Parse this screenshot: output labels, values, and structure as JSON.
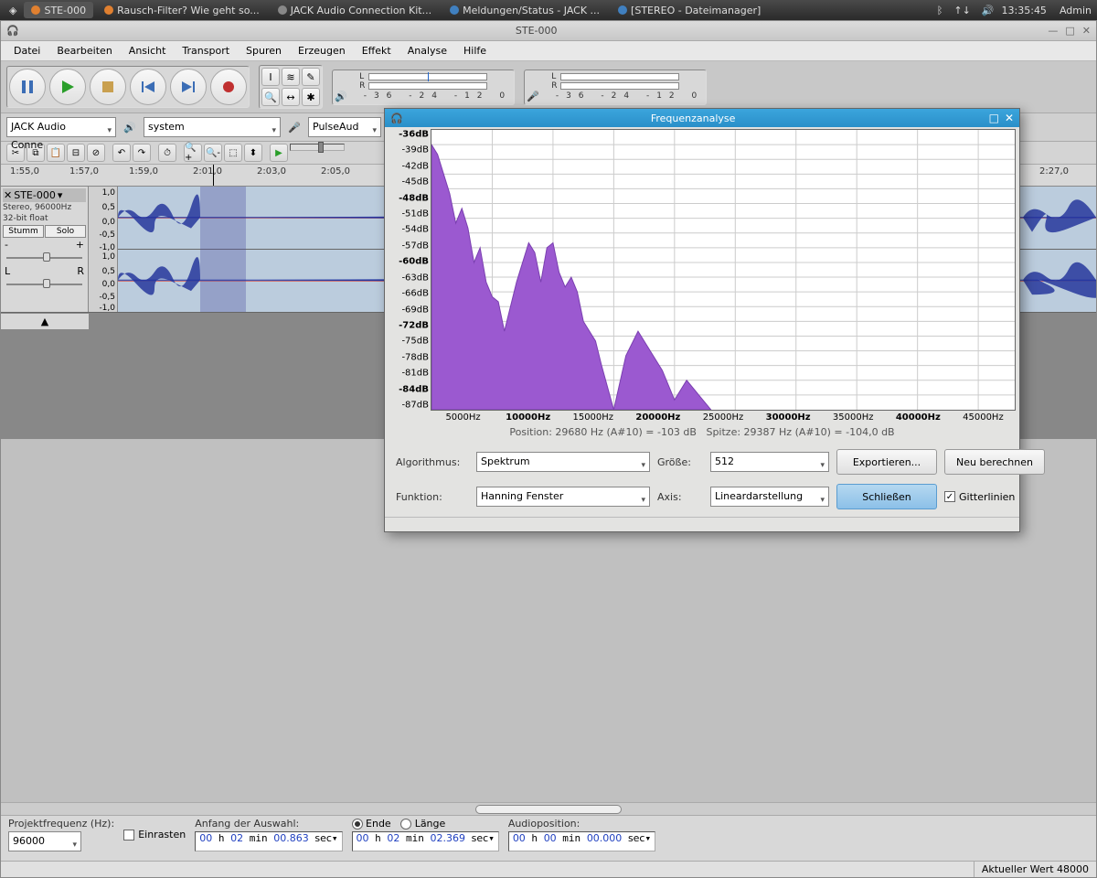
{
  "panel": {
    "tasks": [
      "STE-000",
      "Rausch-Filter? Wie geht so...",
      "JACK Audio Connection Kit...",
      "Meldungen/Status - JACK ...",
      "[STEREO - Dateimanager]"
    ],
    "time": "13:35:45",
    "user": "Admin"
  },
  "app": {
    "title": "STE-000",
    "menu": [
      "Datei",
      "Bearbeiten",
      "Ansicht",
      "Transport",
      "Spuren",
      "Erzeugen",
      "Effekt",
      "Analyse",
      "Hilfe"
    ],
    "meter_labels": [
      "L",
      "R"
    ],
    "meter_ticks": "-36 -24 -12  0",
    "devices": {
      "host": "JACK Audio Conne",
      "out": "system",
      "in": "PulseAud"
    }
  },
  "ruler_ticks": [
    "1:55,0",
    "1:57,0",
    "1:59,0",
    "2:01,0",
    "2:03,0",
    "2:05,0",
    "",
    "2:27,0"
  ],
  "track": {
    "name": "STE-000",
    "format": "Stereo, 96000Hz",
    "bits": "32-bit float",
    "mute": "Stumm",
    "solo": "Solo",
    "pan_l": "L",
    "pan_r": "R",
    "vscale": [
      "1,0",
      "0,5",
      "0,0",
      "-0,5",
      "-1,0"
    ]
  },
  "dialog": {
    "title": "Frequenzanalyse",
    "y_ticks": [
      "-36dB",
      "-39dB",
      "-42dB",
      "-45dB",
      "-48dB",
      "-51dB",
      "-54dB",
      "-57dB",
      "-60dB",
      "-63dB",
      "-66dB",
      "-69dB",
      "-72dB",
      "-75dB",
      "-78dB",
      "-81dB",
      "-84dB",
      "-87dB"
    ],
    "x_ticks": [
      "5000Hz",
      "10000Hz",
      "15000Hz",
      "20000Hz",
      "25000Hz",
      "30000Hz",
      "35000Hz",
      "40000Hz",
      "45000Hz"
    ],
    "info_pos": "Position: 29680 Hz (A#10) = -103 dB",
    "info_peak": "Spitze: 29387 Hz (A#10) = -104,0 dB",
    "labels": {
      "algo": "Algorithmus:",
      "size": "Größe:",
      "func": "Funktion:",
      "axis": "Axis:"
    },
    "values": {
      "algo": "Spektrum",
      "size": "512",
      "func": "Hanning Fenster",
      "axis": "Lineardarstellung"
    },
    "buttons": {
      "export": "Exportieren...",
      "recalc": "Neu berechnen",
      "close": "Schließen",
      "grid": "Gitterlinien"
    }
  },
  "status": {
    "freq_label": "Projektfrequenz (Hz):",
    "freq": "96000",
    "snap": "Einrasten",
    "sel_label": "Anfang der Auswahl:",
    "end": "Ende",
    "len": "Länge",
    "pos_label": "Audioposition:",
    "t1": {
      "h": "00",
      "m": "02",
      "s": "00.863",
      "u": "sec"
    },
    "t2": {
      "h": "00",
      "m": "02",
      "s": "02.369",
      "u": "sec"
    },
    "t3": {
      "h": "00",
      "m": "00",
      "s": "00.000",
      "u": "sec"
    },
    "footer": "Aktueller Wert 48000"
  },
  "chart_data": {
    "type": "area",
    "title": "Frequenzanalyse",
    "xlabel": "Hz",
    "ylabel": "dB",
    "xlim": [
      0,
      48000
    ],
    "ylim": [
      -90,
      -33
    ],
    "x_ticks": [
      5000,
      10000,
      15000,
      20000,
      25000,
      30000,
      35000,
      40000,
      45000
    ],
    "y_ticks": [
      -36,
      -39,
      -42,
      -45,
      -48,
      -51,
      -54,
      -57,
      -60,
      -63,
      -66,
      -69,
      -72,
      -75,
      -78,
      -81,
      -84,
      -87
    ],
    "series": [
      {
        "name": "spectrum",
        "x": [
          0,
          500,
          1000,
          1500,
          2000,
          2500,
          3000,
          3500,
          4000,
          4500,
          5000,
          5500,
          6000,
          7000,
          7500,
          8000,
          8500,
          9000,
          9500,
          10000,
          10500,
          11000,
          11500,
          12000,
          12500,
          13000,
          13500,
          14000,
          15000,
          16000,
          17000,
          18000,
          19000,
          20000,
          21000,
          22000,
          23000
        ],
        "y": [
          -36,
          -38,
          -42,
          -46,
          -52,
          -49,
          -53,
          -60,
          -57,
          -64,
          -67,
          -68,
          -74,
          -64,
          -60,
          -56,
          -58,
          -64,
          -57,
          -56,
          -62,
          -65,
          -63,
          -66,
          -72,
          -74,
          -76,
          -81,
          -90,
          -79,
          -74,
          -78,
          -82,
          -88,
          -84,
          -87,
          -90
        ]
      }
    ],
    "grid": true,
    "cursor_info": {
      "position_hz": 29680,
      "position_db": -103,
      "peak_hz": 29387,
      "peak_db": -104.0,
      "peak_note": "A#10"
    }
  }
}
